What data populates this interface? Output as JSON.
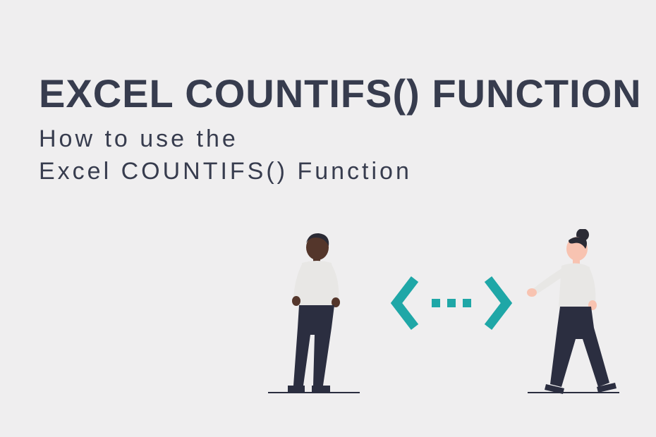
{
  "title": "EXCEL COUNTIFS() FUNCTION",
  "subtitle": "How to use the\nExcel COUNTIFS() Function",
  "colors": {
    "background": "#efeeef",
    "text": "#373c4e",
    "accent": "#1fa7a7",
    "skin_dark": "#54362b",
    "skin_light": "#f8c3b1",
    "clothing_light": "#e8e7e5",
    "clothing_dark": "#2b2e40",
    "hair": "#2b2b35"
  },
  "icons": {
    "left_bracket": "chevron-left",
    "right_bracket": "chevron-right",
    "dots": "ellipsis"
  }
}
